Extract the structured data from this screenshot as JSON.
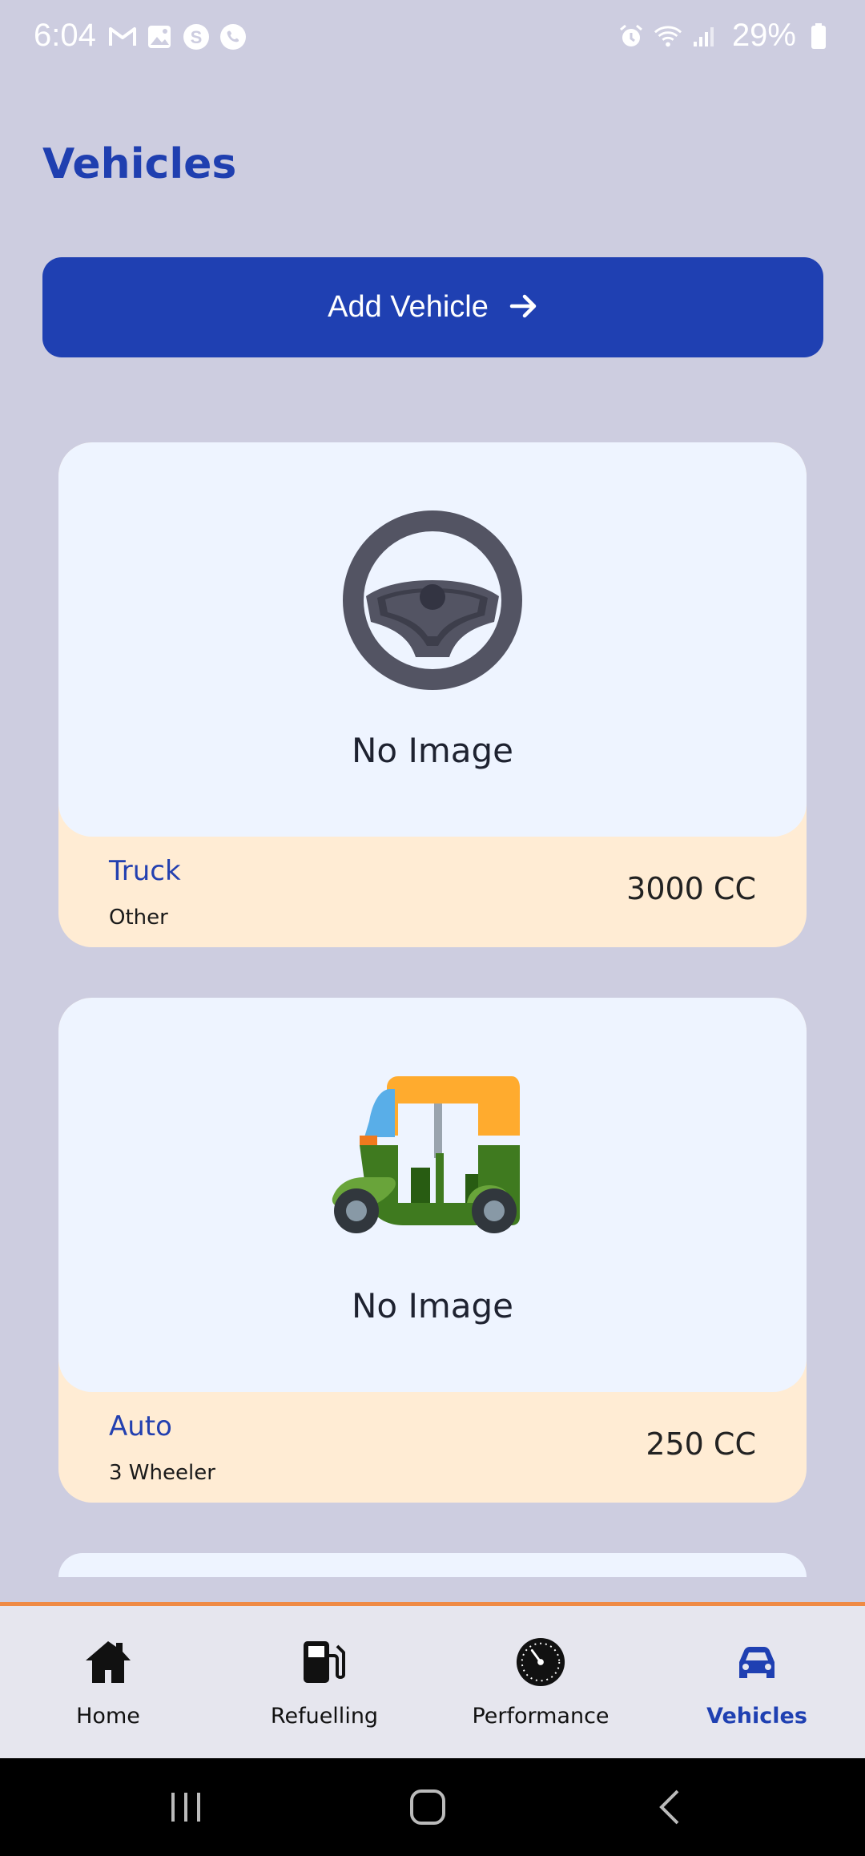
{
  "status_bar": {
    "time": "6:04",
    "battery": "29%",
    "left_icons": [
      "gmail-icon",
      "gallery-icon",
      "skype-icon",
      "viber-icon"
    ],
    "right_icons": [
      "alarm-icon",
      "wifi-icon",
      "signal-icon",
      "battery-icon"
    ]
  },
  "page": {
    "title": "Vehicles"
  },
  "add_button": {
    "label": "Add Vehicle",
    "icon": "arrow-right-icon"
  },
  "vehicles": [
    {
      "image_placeholder": "No Image",
      "icon": "steering-wheel-icon",
      "name": "Truck",
      "type": "Other",
      "engine": "3000 CC"
    },
    {
      "image_placeholder": "No Image",
      "icon": "auto-rickshaw-icon",
      "name": "Auto",
      "type": "3 Wheeler",
      "engine": "250 CC"
    }
  ],
  "bottom_nav": {
    "items": [
      {
        "label": "Home",
        "icon": "home-icon",
        "active": false
      },
      {
        "label": "Refuelling",
        "icon": "fuel-pump-icon",
        "active": false
      },
      {
        "label": "Performance",
        "icon": "speedometer-icon",
        "active": false
      },
      {
        "label": "Vehicles",
        "icon": "car-icon",
        "active": true
      }
    ]
  },
  "colors": {
    "background": "#cdcde0",
    "primary": "#1f40b2",
    "card_image_bg": "#eef4ff",
    "card_footer_bg": "#ffecd4",
    "nav_accent_line": "#ef8a44"
  }
}
